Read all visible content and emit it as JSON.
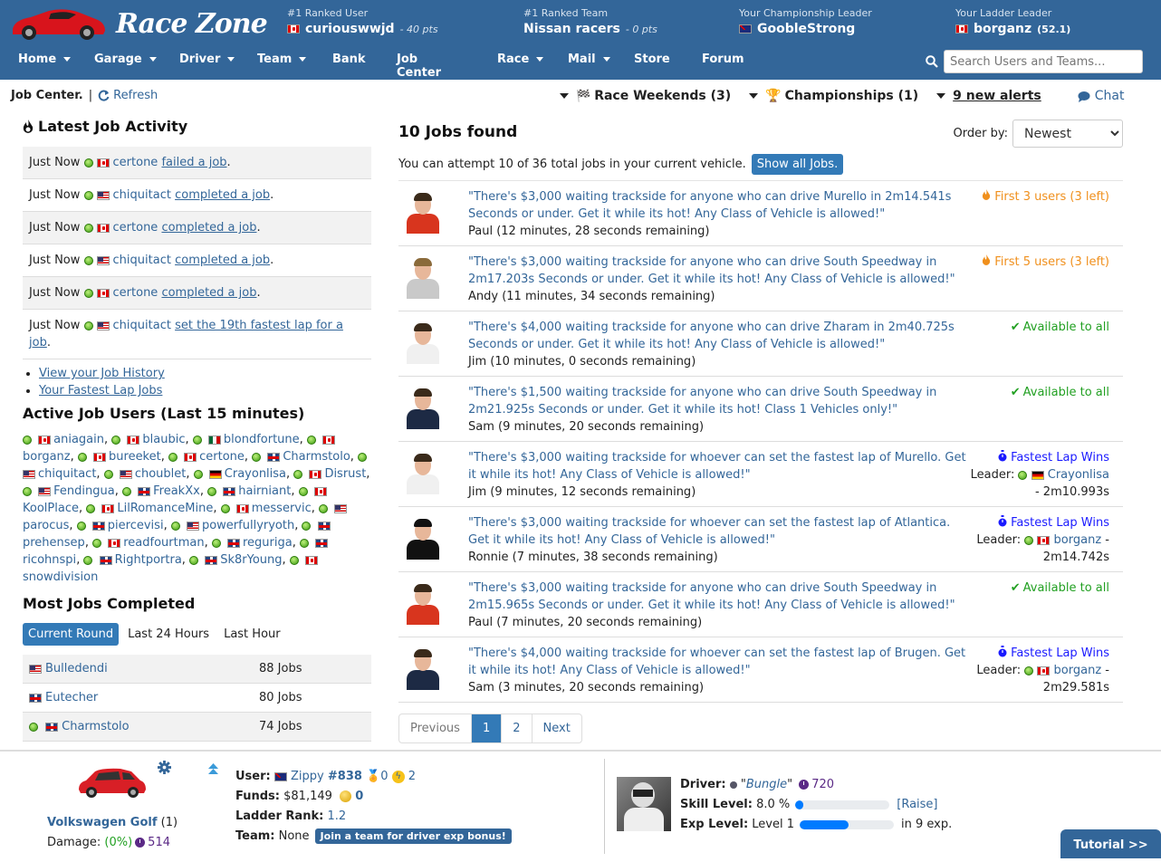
{
  "brand": {
    "name": "Race Zone"
  },
  "header": {
    "ranked_user": {
      "label": "#1 Ranked User",
      "name": "curiouswwjd",
      "pts": "- 40 pts",
      "flag": "ca"
    },
    "ranked_team": {
      "label": "#1 Ranked Team",
      "name": "Nissan racers",
      "pts": "- 0 pts"
    },
    "championship_leader": {
      "label": "Your Championship Leader",
      "name": "GoobleStrong",
      "flag": "nz"
    },
    "ladder_leader": {
      "label": "Your Ladder Leader",
      "name": "borganz",
      "score": "(52.1)",
      "flag": "ca"
    }
  },
  "nav": [
    {
      "label": "Home",
      "dropdown": true
    },
    {
      "label": "Garage",
      "dropdown": true
    },
    {
      "label": "Driver",
      "dropdown": true
    },
    {
      "label": "Team",
      "dropdown": true
    },
    {
      "label": "Bank",
      "dropdown": false
    },
    {
      "label": "Job Center",
      "dropdown": false
    },
    {
      "label": "Race",
      "dropdown": true
    },
    {
      "label": "Mail",
      "dropdown": true
    },
    {
      "label": "Store",
      "dropdown": false
    },
    {
      "label": "Forum",
      "dropdown": false
    }
  ],
  "search": {
    "placeholder": "Search Users and Teams..."
  },
  "subbar": {
    "title": "Job Center.",
    "sep": "|",
    "refresh": "Refresh",
    "race_weekends": "Race Weekends (3)",
    "championships": "Championships (1)",
    "alerts": "9 new alerts",
    "chat": "Chat"
  },
  "latest_activity": {
    "title": "Latest Job Activity",
    "items": [
      {
        "time": "Just Now",
        "flag": "ca",
        "user": "certone",
        "action": "failed a job"
      },
      {
        "time": "Just Now",
        "flag": "us",
        "user": "chiquitact",
        "action": "completed a job"
      },
      {
        "time": "Just Now",
        "flag": "ca",
        "user": "certone",
        "action": "completed a job"
      },
      {
        "time": "Just Now",
        "flag": "us",
        "user": "chiquitact",
        "action": "completed a job"
      },
      {
        "time": "Just Now",
        "flag": "ca",
        "user": "certone",
        "action": "completed a job"
      },
      {
        "time": "Just Now",
        "flag": "us",
        "user": "chiquitact",
        "action": "set the 19th fastest lap for a job"
      }
    ],
    "links": [
      "View your Job History",
      "Your Fastest Lap Jobs"
    ]
  },
  "active_users": {
    "title": "Active Job Users (Last 15 minutes)",
    "users": [
      {
        "name": "aniagain",
        "flag": "ca"
      },
      {
        "name": "blaubic",
        "flag": "ca"
      },
      {
        "name": "blondfortune",
        "flag": "mx"
      },
      {
        "name": "borganz",
        "flag": "ca"
      },
      {
        "name": "bureeket",
        "flag": "ca"
      },
      {
        "name": "certone",
        "flag": "ca"
      },
      {
        "name": "Charmstolo",
        "flag": "gb"
      },
      {
        "name": "chiquitact",
        "flag": "us"
      },
      {
        "name": "choublet",
        "flag": "us"
      },
      {
        "name": "Crayonlisa",
        "flag": "de"
      },
      {
        "name": "Disrust",
        "flag": "ca"
      },
      {
        "name": "Fendingua",
        "flag": "us"
      },
      {
        "name": "FreakXx",
        "flag": "gb"
      },
      {
        "name": "hairniant",
        "flag": "gb"
      },
      {
        "name": "KoolPlace",
        "flag": "ca"
      },
      {
        "name": "LilRomanceMine",
        "flag": "ca"
      },
      {
        "name": "messervic",
        "flag": "ca"
      },
      {
        "name": "parocus",
        "flag": "us"
      },
      {
        "name": "piercevisi",
        "flag": "gb"
      },
      {
        "name": "powerfullyryoth",
        "flag": "us"
      },
      {
        "name": "prehensep",
        "flag": "gb"
      },
      {
        "name": "readfourtman",
        "flag": "ca"
      },
      {
        "name": "reguriga",
        "flag": "gb"
      },
      {
        "name": "ricohnspi",
        "flag": "gb"
      },
      {
        "name": "Rightportra",
        "flag": "gb"
      },
      {
        "name": "Sk8rYoung",
        "flag": "gb"
      },
      {
        "name": "snowdivision",
        "flag": "ca"
      }
    ]
  },
  "most_jobs": {
    "title": "Most Jobs Completed",
    "tabs": [
      "Current Round",
      "Last 24 Hours",
      "Last Hour"
    ],
    "active_tab": 0,
    "rows": [
      {
        "name": "Bulledendi",
        "flag": "us",
        "online": false,
        "jobs": "88 Jobs"
      },
      {
        "name": "Eutecher",
        "flag": "gb",
        "online": false,
        "jobs": "80 Jobs"
      },
      {
        "name": "Charmstolo",
        "flag": "gb",
        "online": true,
        "jobs": "74 Jobs"
      }
    ]
  },
  "jobs": {
    "title": "10 Jobs found",
    "order_label": "Order by:",
    "order_value": "Newest",
    "attempt_text": "You can attempt 10 of 36 total jobs in your current vehicle.",
    "show_all": "Show all Jobs.",
    "items": [
      {
        "quote": "\"There's $3,000 waiting trackside for anyone who can drive Murello in 2m14.541s Seconds or under. Get it while its hot! Any Class of Vehicle is allowed!\"",
        "who": "Paul (12 minutes, 28 seconds remaining)",
        "type": "first",
        "status": "First 3 users (3 left)",
        "avatar": "paul"
      },
      {
        "quote": "\"There's $3,000 waiting trackside for anyone who can drive South Speedway in 2m17.203s Seconds or under. Get it while its hot! Any Class of Vehicle is allowed!\"",
        "who": "Andy (11 minutes, 34 seconds remaining)",
        "type": "first",
        "status": "First 5 users (3 left)",
        "avatar": "andy"
      },
      {
        "quote": "\"There's $4,000 waiting trackside for anyone who can drive Zharam in 2m40.725s Seconds or under. Get it while its hot! Any Class of Vehicle is allowed!\"",
        "who": "Jim (10 minutes, 0 seconds remaining)",
        "type": "all",
        "status": "Available to all",
        "avatar": "jim"
      },
      {
        "quote": "\"There's $1,500 waiting trackside for anyone who can drive South Speedway in 2m21.925s Seconds or under. Get it while its hot! Class 1 Vehicles only!\"",
        "who": "Sam (9 minutes, 20 seconds remaining)",
        "type": "all",
        "status": "Available to all",
        "avatar": "sam"
      },
      {
        "quote": "\"There's $3,000 waiting trackside for whoever can set the fastest lap of Murello. Get it while its hot! Any Class of Vehicle is allowed!\"",
        "who": "Jim (9 minutes, 12 seconds remaining)",
        "type": "lap",
        "status": "Fastest Lap Wins",
        "leader_label": "Leader:",
        "leader": "Crayonlisa",
        "leader_flag": "de",
        "leader_time": "- 2m10.993s",
        "avatar": "jim"
      },
      {
        "quote": "\"There's $3,000 waiting trackside for whoever can set the fastest lap of Atlantica. Get it while its hot! Any Class of Vehicle is allowed!\"",
        "who": "Ronnie (7 minutes, 38 seconds remaining)",
        "type": "lap",
        "status": "Fastest Lap Wins",
        "leader_label": "Leader:",
        "leader": "borganz",
        "leader_flag": "ca",
        "leader_time": "- 2m14.742s",
        "avatar": "ronnie"
      },
      {
        "quote": "\"There's $3,000 waiting trackside for anyone who can drive South Speedway in 2m15.965s Seconds or under. Get it while its hot! Any Class of Vehicle is allowed!\"",
        "who": "Paul (7 minutes, 20 seconds remaining)",
        "type": "all",
        "status": "Available to all",
        "avatar": "paul"
      },
      {
        "quote": "\"There's $4,000 waiting trackside for whoever can set the fastest lap of Brugen. Get it while its hot! Any Class of Vehicle is allowed!\"",
        "who": "Sam (3 minutes, 20 seconds remaining)",
        "type": "lap",
        "status": "Fastest Lap Wins",
        "leader_label": "Leader:",
        "leader": "borganz",
        "leader_flag": "ca",
        "leader_time": "- 2m29.581s",
        "avatar": "sam"
      }
    ],
    "pagination": [
      "Previous",
      "1",
      "2",
      "Next"
    ],
    "current_page": "1"
  },
  "footer": {
    "car_name": "Volkswagen Golf",
    "car_count": "(1)",
    "damage_label": "Damage:",
    "damage_value": "(0%)",
    "damage_clock": "514",
    "user_label": "User:",
    "user_name": "Zippy",
    "user_rank": "#838",
    "medals": "0",
    "bolts": "2",
    "funds_label": "Funds:",
    "funds": "$81,149",
    "coins": "0",
    "ladder_label": "Ladder Rank:",
    "ladder": "1.2",
    "team_label": "Team:",
    "team": "None",
    "team_badge": "Join a team for driver exp bonus!",
    "driver_label": "Driver:",
    "driver_name": "Bungle",
    "driver_clock": "720",
    "skill_label": "Skill Level:",
    "skill_value": "8.0 %",
    "skill_pct": 8,
    "raise": "[Raise]",
    "exp_label": "Exp Level:",
    "exp_value": "Level 1",
    "exp_pct": 52,
    "exp_remaining": "in 9 exp.",
    "tutorial": "Tutorial >>"
  }
}
